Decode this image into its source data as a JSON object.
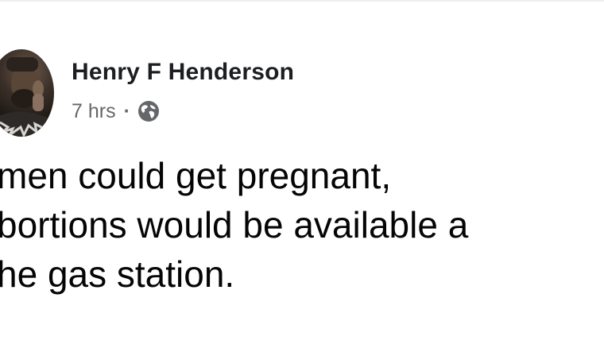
{
  "post": {
    "author": {
      "name": "Henry F Henderson",
      "avatar_icon": "profile-photo"
    },
    "meta": {
      "time": "7 hrs",
      "separator": "·",
      "privacy_icon": "globe-icon"
    },
    "text_lines": [
      "men could get pregnant,",
      "bortions would be available a",
      "he gas station."
    ]
  },
  "colors": {
    "name": "#1c1e21",
    "meta": "#65676b",
    "body_text": "#050505",
    "background": "#ffffff"
  }
}
